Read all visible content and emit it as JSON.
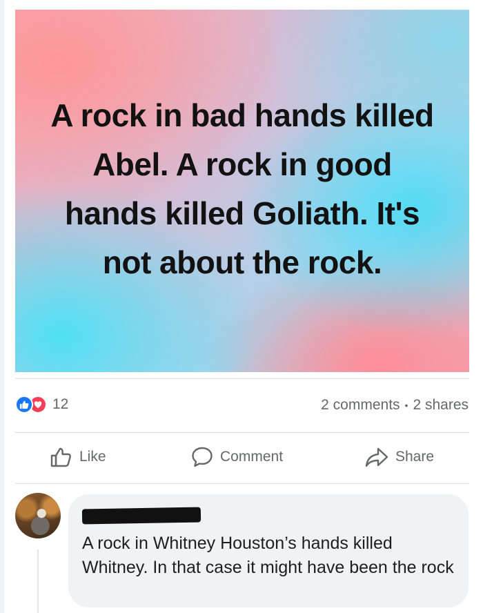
{
  "post": {
    "image_text": "A rock in bad hands killed Abel. A rock in good hands killed Goliath. It's not about the rock.",
    "image_gradient_colors": [
      "#f6a9b6",
      "#a7d6ee",
      "#50e1f5",
      "#f48c96"
    ]
  },
  "stats": {
    "reaction_count": "12",
    "reaction_types": [
      "like-icon",
      "love-icon"
    ],
    "comments": "2 comments",
    "separator": "•",
    "shares": "2 shares"
  },
  "actions": {
    "like": "Like",
    "comment": "Comment",
    "share": "Share"
  },
  "comment": {
    "author": "",
    "text": "A rock in Whitney Houston’s hands killed Whitney. In that case it might have been the rock"
  },
  "colors": {
    "like_blue": "#1877f2",
    "love_red": "#f33e58",
    "secondary_text": "#65676b",
    "bubble_bg": "#f0f2f5"
  }
}
